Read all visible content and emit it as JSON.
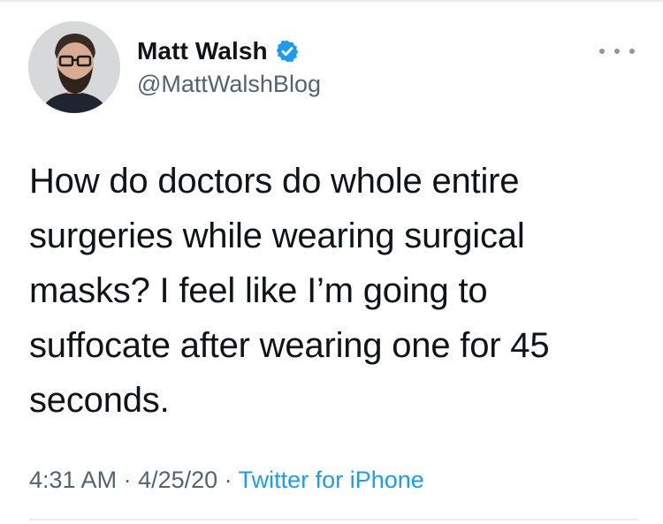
{
  "author": {
    "display_name": "Matt Walsh",
    "handle": "@MattWalshBlog",
    "verified": true
  },
  "tweet": {
    "text": "How do doctors do whole entire surgeries while wearing surgical masks? I feel like I’m going to suffocate after wearing one for 45 seconds."
  },
  "meta": {
    "time": "4:31 AM",
    "separator": " · ",
    "date": "4/25/20",
    "source": "Twitter for iPhone"
  },
  "icons": {
    "verified": "verified-badge-icon",
    "more": "more-options-icon"
  },
  "colors": {
    "text": "#0f1419",
    "secondary": "#536471",
    "accent": "#1d9bf0"
  }
}
